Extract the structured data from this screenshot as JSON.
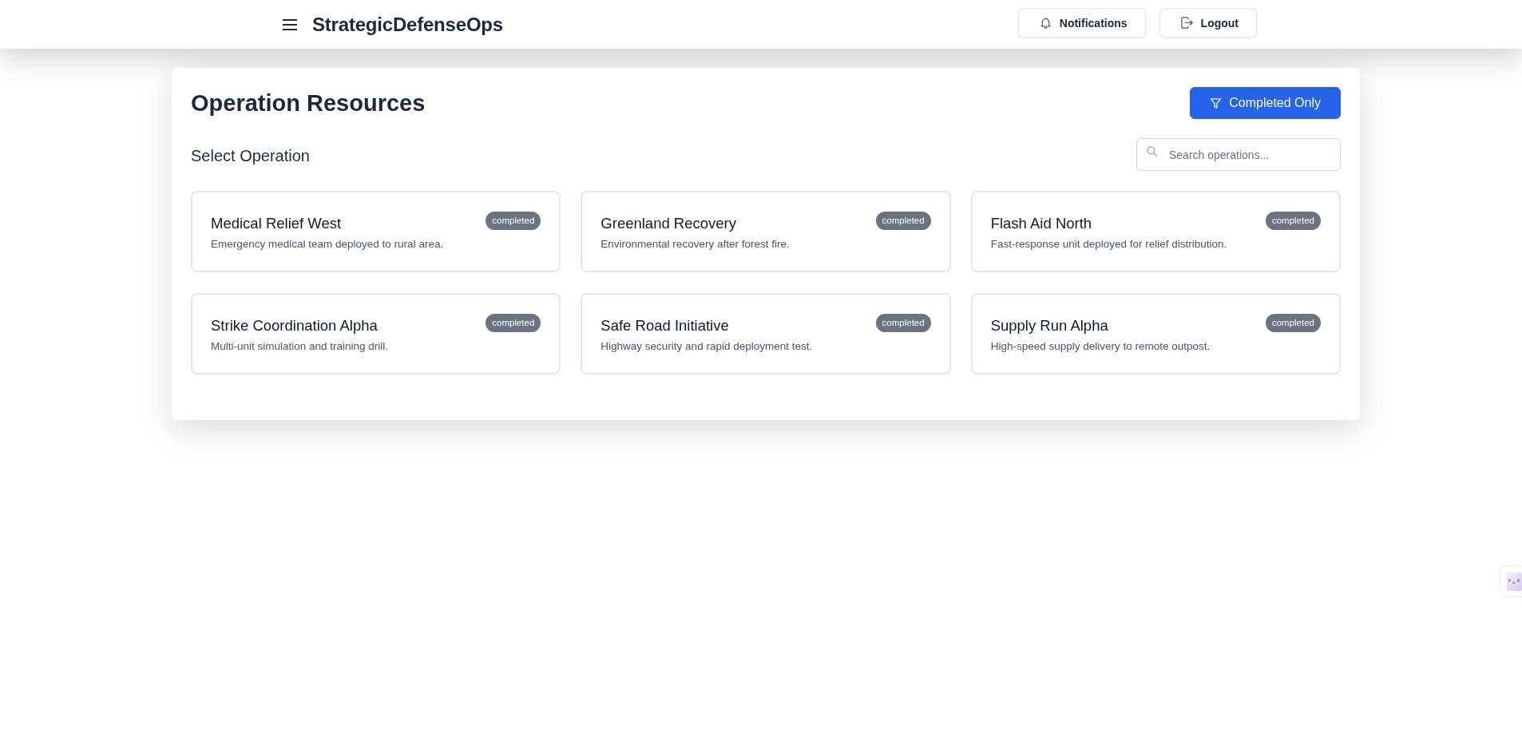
{
  "header": {
    "title": "StrategicDefenseOps",
    "buttons": [
      {
        "kind": "notifications",
        "label": "Notifications"
      },
      {
        "kind": "logout",
        "label": "Logout"
      }
    ]
  },
  "panel": {
    "title": "Operation Resources",
    "filter_button": {
      "label": "Completed Only",
      "active": true
    },
    "section_label": "Select Operation",
    "search": {
      "placeholder": "Search operations..."
    },
    "operations": [
      {
        "name": "Medical Relief West",
        "description": "Emergency medical team deployed to rural area.",
        "status": "completed"
      },
      {
        "name": "Greenland Recovery",
        "description": "Environmental recovery after forest fire.",
        "status": "completed"
      },
      {
        "name": "Flash Aid North",
        "description": "Fast-response unit deployed for relief distribution.",
        "status": "completed"
      },
      {
        "name": "Strike Coordination Alpha",
        "description": "Multi-unit simulation and training drill.",
        "status": "completed"
      },
      {
        "name": "Safe Road Initiative",
        "description": "Highway security and rapid deployment test.",
        "status": "completed"
      },
      {
        "name": "Supply Run Alpha",
        "description": "High-speed supply delivery to remote outpost.",
        "status": "completed"
      }
    ]
  }
}
